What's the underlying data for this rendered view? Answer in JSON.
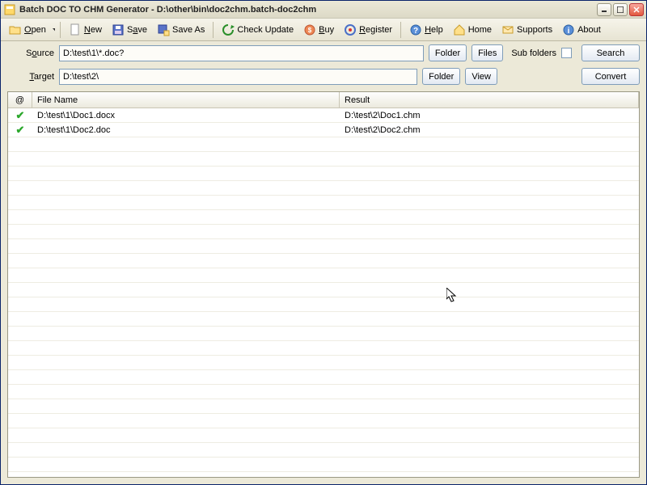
{
  "window": {
    "title": "Batch DOC TO CHM Generator - D:\\other\\bin\\doc2chm.batch-doc2chm"
  },
  "toolbar": {
    "open": "Open",
    "new": "New",
    "save": "Save",
    "save_as": "Save As",
    "check_update": "Check Update",
    "buy": "Buy",
    "register": "Register",
    "help": "Help",
    "home": "Home",
    "supports": "Supports",
    "about": "About"
  },
  "source": {
    "label": "Source",
    "value": "D:\\test\\1\\*.doc?",
    "folder_btn": "Folder",
    "files_btn": "Files",
    "subfolders_label": "Sub folders",
    "search_btn": "Search"
  },
  "target": {
    "label": "Target",
    "value": "D:\\test\\2\\",
    "folder_btn": "Folder",
    "view_btn": "View",
    "convert_btn": "Convert"
  },
  "list": {
    "headers": {
      "status": "@",
      "filename": "File Name",
      "result": "Result"
    },
    "rows": [
      {
        "file": "D:\\test\\1\\Doc1.docx",
        "result": "D:\\test\\2\\Doc1.chm"
      },
      {
        "file": "D:\\test\\1\\Doc2.doc",
        "result": "D:\\test\\2\\Doc2.chm"
      }
    ]
  }
}
